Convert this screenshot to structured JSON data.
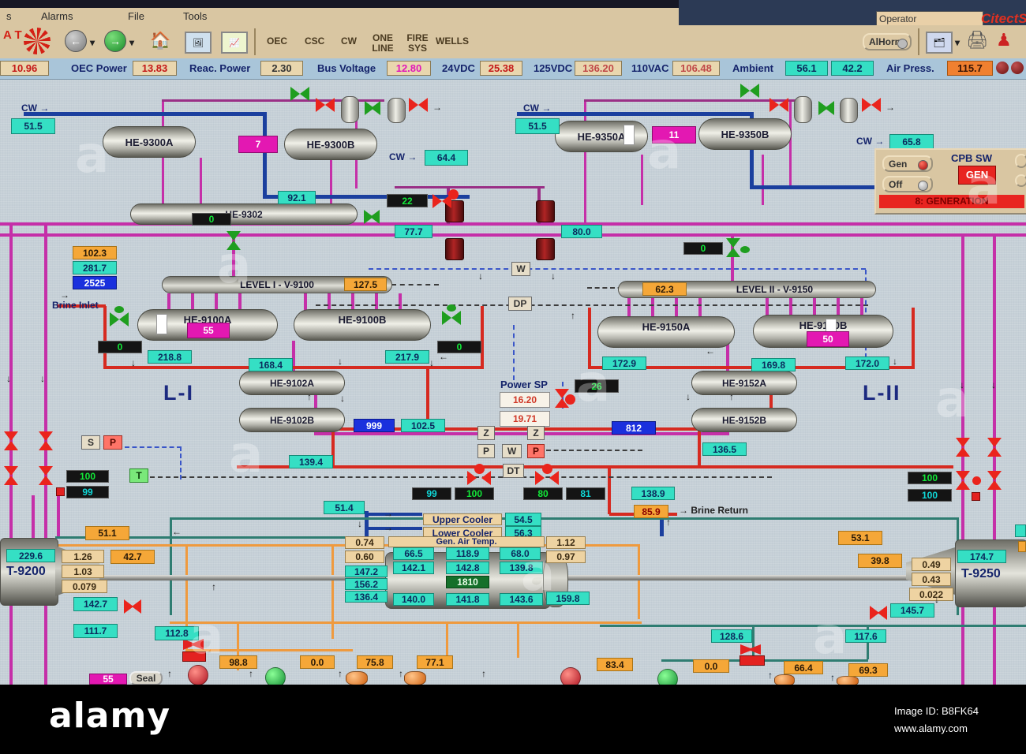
{
  "chrome": {
    "menu_partial": "s",
    "menu_items": [
      "Alarms",
      "File",
      "Tools"
    ],
    "logo_text": "A T",
    "nav_buttons": [
      "OEC",
      "CSC",
      "CW",
      "ONE LINE",
      "FIRE SYS",
      "WELLS"
    ],
    "operator_field": "Operator",
    "alhorn_button": "AlHorn",
    "citect_logo": "CitectS"
  },
  "statusbar": {
    "left_value": "10.96",
    "items": [
      {
        "label": "OEC Power",
        "value": "13.83"
      },
      {
        "label": "Reac. Power",
        "value": "2.30"
      },
      {
        "label": "Bus Voltage",
        "value": "12.80"
      },
      {
        "label": "24VDC",
        "value": "25.38"
      },
      {
        "label": "125VDC",
        "value": "136.20"
      },
      {
        "label": "110VAC",
        "value": "106.48"
      },
      {
        "label": "Ambient",
        "value": "56.1",
        "value2": "42.2"
      },
      {
        "label": "Air Press.",
        "value": "115.7"
      }
    ]
  },
  "panel": {
    "title": "CPB SW",
    "gen_button": "Gen",
    "off_button": "Off",
    "gen_mode": "GEN",
    "banner": "8: GENERATION"
  },
  "labels": {
    "cw_in_left": "CW →",
    "cw_out_left": "CW →",
    "cw_in_right": "CW →",
    "cw_out_right": "CW →",
    "brine_inlet": "Brine Inlet",
    "brine_return": "→ Brine Return",
    "power_sp": "Power SP",
    "upper_cooler": "Upper Cooler",
    "lower_cooler": "Lower Cooler",
    "gen_air_temp": "Gen. Air Temp.",
    "seal": "Seal",
    "section_left": "L-I",
    "section_right": "L-II"
  },
  "equipment": {
    "he9300a": "HE-9300A",
    "he9300b": "HE-9300B",
    "he9302": "HE-9302",
    "he9350a": "HE-9350A",
    "he9350b": "HE-9350B",
    "level1": "LEVEL I - V-9100",
    "level2": "LEVEL II - V-9150",
    "he9100a": "HE-9100A",
    "he9100b": "HE-9100B",
    "he9150a": "HE-9150A",
    "he9150b": "HE-9150B",
    "he9102a": "HE-9102A",
    "he9102b": "HE-9102B",
    "he9152a": "HE-9152A",
    "he9152b": "HE-9152B",
    "t9200": "T-9200",
    "t9250": "T-9250"
  },
  "instruments": {
    "w1": "W",
    "dp": "DP",
    "z1": "Z",
    "z2": "Z",
    "p1": "P",
    "w2": "W",
    "p2": "P",
    "dt": "DT",
    "s": "S",
    "p_left": "P",
    "t": "T"
  },
  "values": {
    "cw_supply_left": "51.5",
    "he9300_level": "7",
    "cw_return_left": "64.4",
    "v92_1": "92.1",
    "v22": "22",
    "v0_top_left": "0",
    "v77_7": "77.7",
    "v102_3": "102.3",
    "v281_7": "281.7",
    "v2525": "2525",
    "v127_5": "127.5",
    "v55": "55",
    "v0_he9100a": "0",
    "v0_he9100b": "0",
    "v218_8": "218.8",
    "v217_9": "217.9",
    "v168_4": "168.4",
    "v999": "999",
    "v102_5": "102.5",
    "v139_4": "139.4",
    "v100_left": "100",
    "v99_left": "99",
    "v16_20": "16.20",
    "v19_71": "19.71",
    "v26": "26",
    "v99_mid": "99",
    "v100_mid": "100",
    "v80": "80",
    "v81": "81",
    "v138_9": "138.9",
    "v85_9": "85.9",
    "v51_4": "51.4",
    "v54_5": "54.5",
    "v56_3": "56.3",
    "cw_supply_right": "51.5",
    "he9350_level": "11",
    "cw_return_right": "65.8",
    "v80_0": "80.0",
    "v0_top_right": "0",
    "v62_3": "62.3",
    "v50": "50",
    "v172_9": "172.9",
    "v172_0": "172.0",
    "v169_8": "169.8",
    "v812": "812",
    "v136_5": "136.5",
    "v100_right_a": "100",
    "v100_right_b": "100",
    "v0_74": "0.74",
    "v0_60": "0.60",
    "v1_12": "1.12",
    "v0_97": "0.97",
    "gt_r1c1": "66.5",
    "gt_r1c2": "118.9",
    "gt_r1c3": "68.0",
    "gt_r2c1": "142.1",
    "gt_r2c2": "142.8",
    "gt_r2c3": "139.8",
    "gt_green": "1810",
    "gt_r3c1": "140.0",
    "gt_r3c2": "141.8",
    "gt_r3c3": "143.6",
    "gt_l1": "147.2",
    "gt_l2": "156.2",
    "gt_l3": "136.4",
    "v159_8": "159.8",
    "v229_6": "229.6",
    "v1_26": "1.26",
    "v1_03": "1.03",
    "v0_079": "0.079",
    "v51_1": "51.1",
    "v42_7": "42.7",
    "v142_7": "142.7",
    "v111_7": "111.7",
    "v112_8": "112.8",
    "v53_1": "53.1",
    "v39_8": "39.8",
    "v0_49": "0.49",
    "v0_43": "0.43",
    "v0_022": "0.022",
    "v174_7": "174.7",
    "v145_7": "145.7",
    "v117_6": "117.6",
    "v128_6": "128.6",
    "v98_8": "98.8",
    "v0_0_left": "0.0",
    "v75_8": "75.8",
    "v77_1": "77.1",
    "v83_4": "83.4",
    "v0_0_right": "0.0",
    "v66_4": "66.4",
    "v69_3": "69.3",
    "v55_bottom": "55"
  },
  "watermark": {
    "brand": "alamy",
    "image_id": "Image ID: B8FK64",
    "site": "www.alamy.com"
  }
}
